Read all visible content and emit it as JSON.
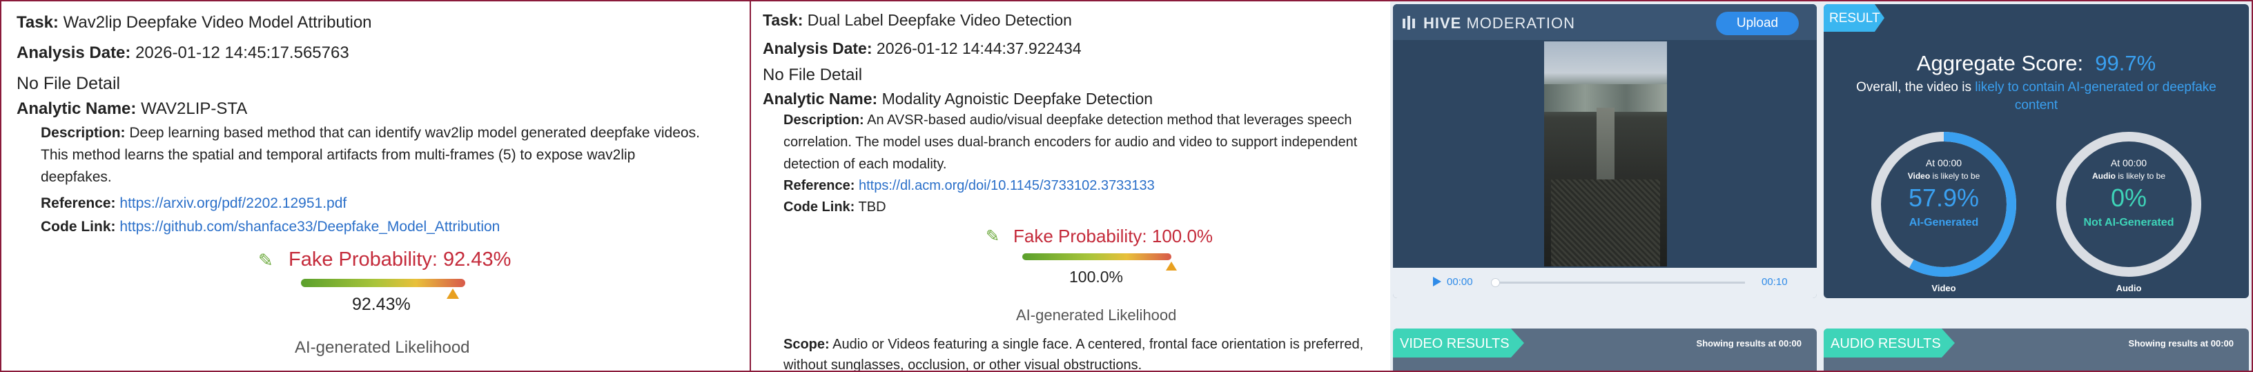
{
  "panel1": {
    "task_label": "Task:",
    "task": "Wav2lip Deepfake Video Model Attribution",
    "date_label": "Analysis Date:",
    "date": "2026-01-12 14:45:17.565763",
    "file_detail": "No File Detail",
    "analytic_label": "Analytic Name:",
    "analytic": "WAV2LIP-STA",
    "desc_label": "Description:",
    "desc_line1": "Deep learning based method that can identify wav2lip model generated deepfake videos.",
    "desc_line2": "This method learns the spatial and temporal artifacts from multi-frames (5) to expose wav2lip",
    "desc_line3": "deepfakes.",
    "ref_label": "Reference:",
    "ref": "https://arxiv.org/pdf/2202.12951.pdf",
    "code_label": "Code Link:",
    "code": "https://github.com/shanface33/Deepfake_Model_Attribution",
    "prob_label": "Fake Probability: 92.43%",
    "prob_value": "92.43%",
    "prob_fraction": 0.9243,
    "likelihood": "AI-generated Likelihood"
  },
  "panel2": {
    "task_label": "Task:",
    "task": "Dual Label Deepfake Video Detection",
    "date_label": "Analysis Date:",
    "date": "2026-01-12 14:44:37.922434",
    "file_detail": "No File Detail",
    "analytic_label": "Analytic Name:",
    "analytic": "Modality Agnoistic Deepfake Detection",
    "desc_label": "Description:",
    "desc_line1": "An AVSR-based audio/visual deepfake detection method that leverages speech",
    "desc_line2": "correlation. The model uses dual-branch encoders for audio and video to support independent",
    "desc_line3": "detection of each modality.",
    "ref_label": "Reference:",
    "ref": "https://dl.acm.org/doi/10.1145/3733102.3733133",
    "code_label": "Code Link:",
    "code": "TBD",
    "prob_label": "Fake Probability: 100.0%",
    "prob_value": "100.0%",
    "prob_fraction": 1.0,
    "likelihood": "AI-generated Likelihood",
    "scope_label": "Scope:",
    "scope_line1": "Audio or Videos featuring a single face. A centered, frontal face orientation is preferred,",
    "scope_line2": "without sunglasses, occlusion, or other visual obstructions."
  },
  "hive": {
    "logo_bold": "HIVE",
    "logo_light": "MODERATION",
    "upload": "Upload",
    "time_start": "00:00",
    "time_end": "00:10",
    "result_tab": "RESULT",
    "agg_label": "Aggregate Score:",
    "agg_value": "99.7%",
    "overall_prefix": "Overall, the video is",
    "overall_highlight": "likely to contain AI-generated or deepfake",
    "overall_highlight2": "content",
    "video": {
      "at": "At 00:00",
      "likely_bold": "Video",
      "likely_rest": "is likely to be",
      "value": "57.9%",
      "fraction": 0.579,
      "verdict": "AI-Generated",
      "caption": "Video"
    },
    "audio": {
      "at": "At 00:00",
      "likely_bold": "Audio",
      "likely_rest": "is likely to be",
      "value": "0%",
      "fraction": 0.0,
      "verdict": "Not AI-Generated",
      "caption": "Audio"
    },
    "video_results": "VIDEO RESULTS",
    "audio_results": "AUDIO RESULTS",
    "showing": "Showing results at",
    "showing_time": "00:00",
    "colors": {
      "accent": "#3aa0f0",
      "teal": "#3ed4b8",
      "card": "#2e4661",
      "prob": "#c42a3a"
    }
  }
}
